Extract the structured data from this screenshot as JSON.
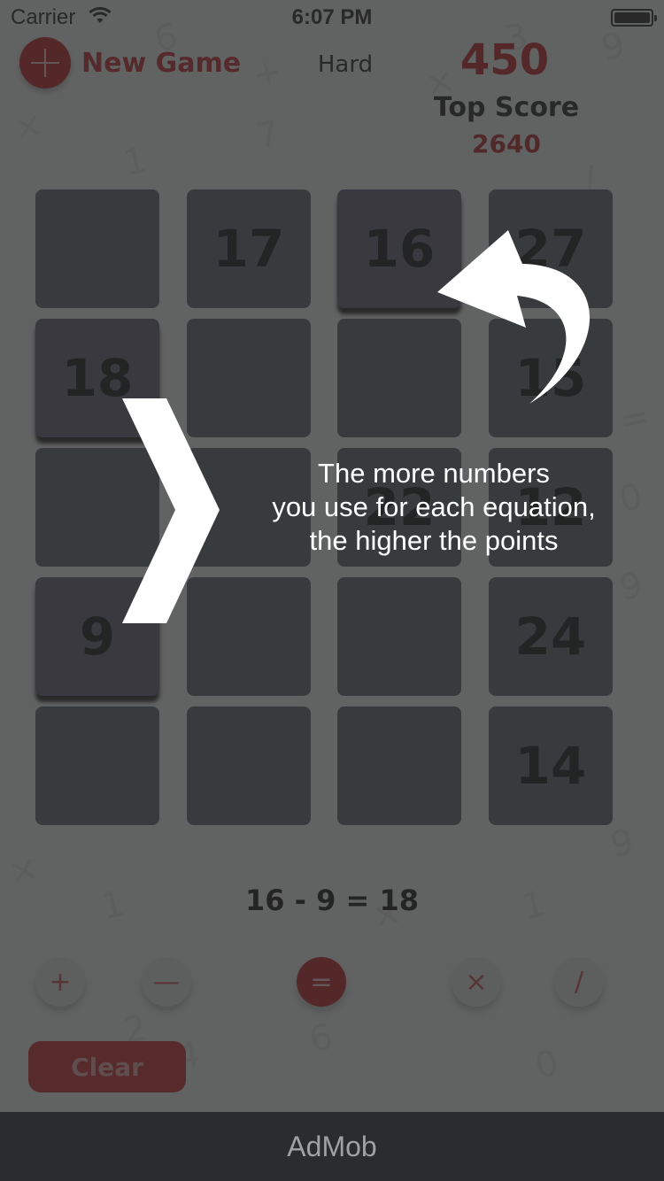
{
  "status_bar": {
    "carrier": "Carrier",
    "time": "6:07 PM"
  },
  "header": {
    "new_game_label": "New Game",
    "difficulty": "Hard",
    "score": "450",
    "top_score_label": "Top Score",
    "top_score_value": "2640"
  },
  "grid": {
    "rows": [
      [
        "",
        "17",
        "16",
        "27"
      ],
      [
        "18",
        "",
        "",
        "15"
      ],
      [
        "",
        "",
        "22",
        "12"
      ],
      [
        "9",
        "",
        "",
        "24"
      ],
      [
        "",
        "",
        "",
        "14"
      ]
    ],
    "selected": [
      "16",
      "18",
      "9"
    ]
  },
  "equation": "16 - 9 = 18",
  "operators": {
    "plus": "+",
    "minus": "—",
    "equals": "=",
    "times": "×",
    "divide": "/"
  },
  "clear_label": "Clear",
  "tutorial": {
    "text": "The more numbers\nyou use for each equation,\nthe higher the points"
  },
  "ad": {
    "label": "AdMob"
  },
  "colors": {
    "accent_red": "#b91d22",
    "tile": "#53616a",
    "tile_selected": "#5f5a73",
    "overlay": "#2d2d2d"
  },
  "icons": {
    "new_game": "plus-circle-icon",
    "wifi": "wifi-icon",
    "battery": "battery-icon",
    "tutorial_chevron": "chevron-right-icon",
    "tutorial_arrow": "curved-arrow-icon"
  }
}
